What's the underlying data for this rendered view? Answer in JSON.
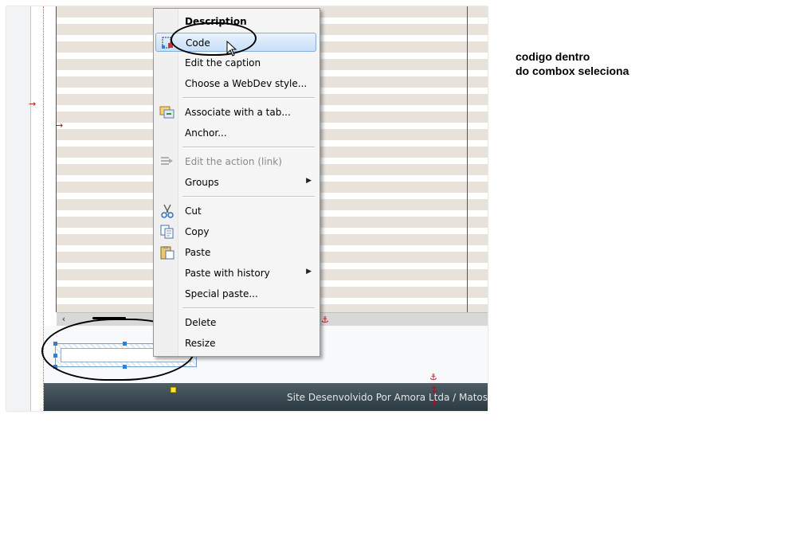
{
  "context_menu": {
    "header": "Description",
    "items": [
      {
        "label": "Code",
        "highlighted": true
      },
      {
        "label": "Edit the caption"
      },
      {
        "label": "Choose a WebDev style..."
      },
      {
        "label": "Associate with a tab...",
        "icon": "associate-tab-icon"
      },
      {
        "label": "Anchor..."
      },
      {
        "label": "Edit the action (link)",
        "disabled": true,
        "icon": "edit-action-icon"
      },
      {
        "label": "Groups",
        "submenu": true
      },
      {
        "label": "Cut",
        "icon": "scissors-icon"
      },
      {
        "label": "Copy",
        "icon": "copy-icon"
      },
      {
        "label": "Paste",
        "icon": "paste-icon"
      },
      {
        "label": "Paste with history",
        "submenu": true
      },
      {
        "label": "Special paste..."
      },
      {
        "label": "Delete"
      },
      {
        "label": "Resize"
      }
    ]
  },
  "footer": {
    "text": "Site Desenvolvido Por Amora Ltda / Matos"
  },
  "annotation": {
    "line1": "codigo dentro",
    "line2": "do combox seleciona"
  },
  "colors": {
    "row_stripe": "#e8e2da",
    "highlight": "#c7dff8",
    "footer_bg": "#2c3a42",
    "anchor_red": "#b01010"
  }
}
